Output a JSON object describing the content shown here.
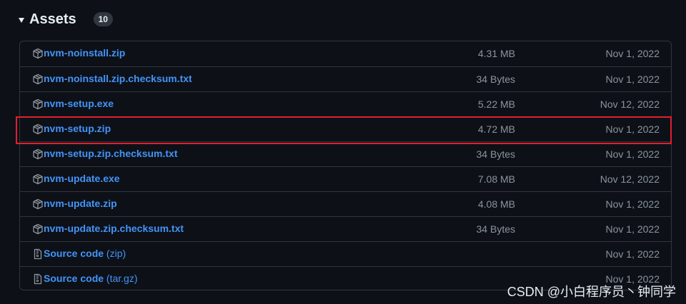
{
  "assets": {
    "title": "Assets",
    "count": "10",
    "items": [
      {
        "name": "nvm-noinstall.zip",
        "ext": "",
        "size": "4.31 MB",
        "date": "Nov 1, 2022",
        "icon": "package-icon"
      },
      {
        "name": "nvm-noinstall.zip.checksum.txt",
        "ext": "",
        "size": "34 Bytes",
        "date": "Nov 1, 2022",
        "icon": "package-icon"
      },
      {
        "name": "nvm-setup.exe",
        "ext": "",
        "size": "5.22 MB",
        "date": "Nov 12, 2022",
        "icon": "package-icon"
      },
      {
        "name": "nvm-setup.zip",
        "ext": "",
        "size": "4.72 MB",
        "date": "Nov 1, 2022",
        "icon": "package-icon"
      },
      {
        "name": "nvm-setup.zip.checksum.txt",
        "ext": "",
        "size": "34 Bytes",
        "date": "Nov 1, 2022",
        "icon": "package-icon"
      },
      {
        "name": "nvm-update.exe",
        "ext": "",
        "size": "7.08 MB",
        "date": "Nov 12, 2022",
        "icon": "package-icon"
      },
      {
        "name": "nvm-update.zip",
        "ext": "",
        "size": "4.08 MB",
        "date": "Nov 1, 2022",
        "icon": "package-icon"
      },
      {
        "name": "nvm-update.zip.checksum.txt",
        "ext": "",
        "size": "34 Bytes",
        "date": "Nov 1, 2022",
        "icon": "package-icon"
      },
      {
        "name": "Source code",
        "ext": " (zip)",
        "size": "",
        "date": "Nov 1, 2022",
        "icon": "file-zip-icon"
      },
      {
        "name": "Source code",
        "ext": " (tar.gz)",
        "size": "",
        "date": "Nov 1, 2022",
        "icon": "file-zip-icon"
      }
    ]
  },
  "watermark": "CSDN @小白程序员丶钟同学",
  "colors": {
    "background": "#0d1117",
    "link": "#4493f8",
    "muted": "#8b949e",
    "border": "#30363d",
    "highlight": "#e0202e"
  }
}
